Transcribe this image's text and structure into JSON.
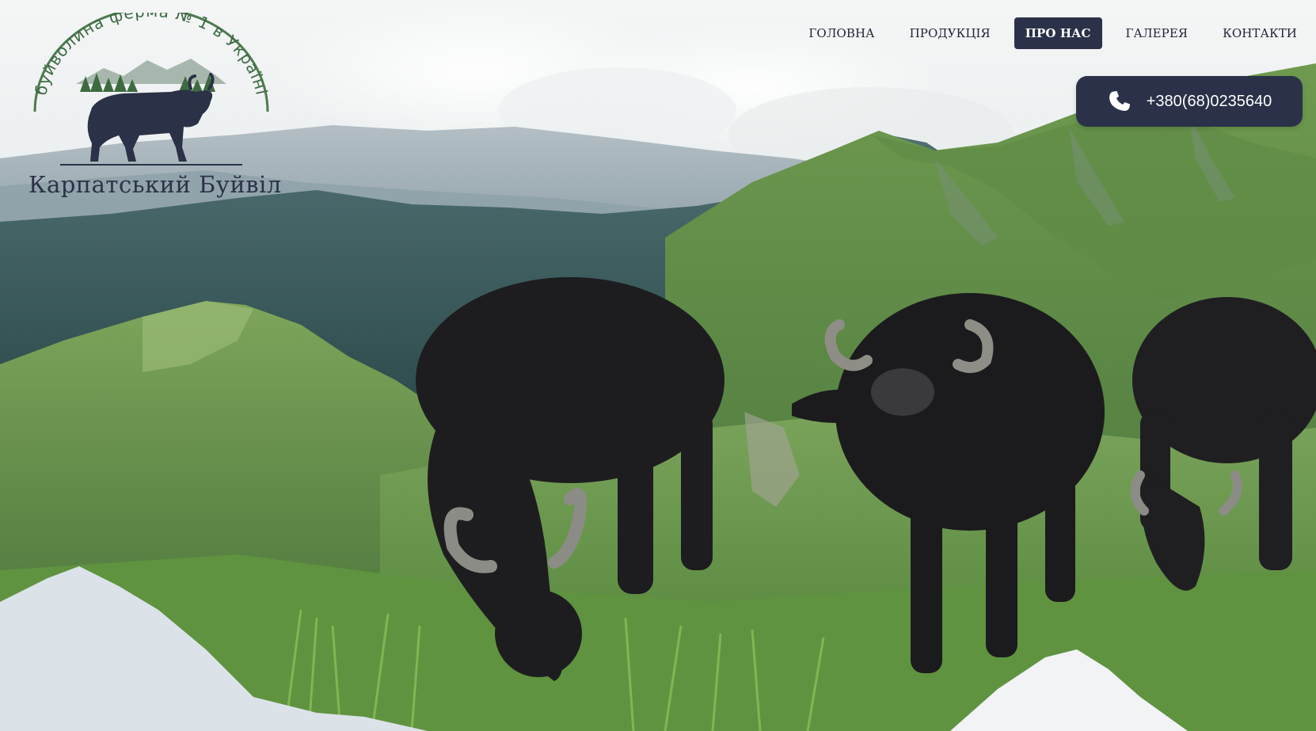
{
  "logo": {
    "arc_text": "буйволина ферма № 1 в Україні",
    "title": "Карпатський Буйвіл"
  },
  "nav": {
    "items": [
      {
        "label": "ГОЛОВНА"
      },
      {
        "label": "ПРОДУКЦІЯ"
      },
      {
        "label": "ПРО НАС",
        "active": true
      },
      {
        "label": "ГАЛЕРЕЯ"
      },
      {
        "label": "КОНТАКТИ"
      }
    ]
  },
  "phone": {
    "number": "+380(68)0235640",
    "icon": "phone-icon"
  },
  "hero": {
    "icons": [
      "mountain-landscape",
      "buffalo-herd"
    ]
  },
  "colors": {
    "brand_dark": "#2a3148",
    "logo_green": "#4e7a4e",
    "white": "#ffffff"
  }
}
